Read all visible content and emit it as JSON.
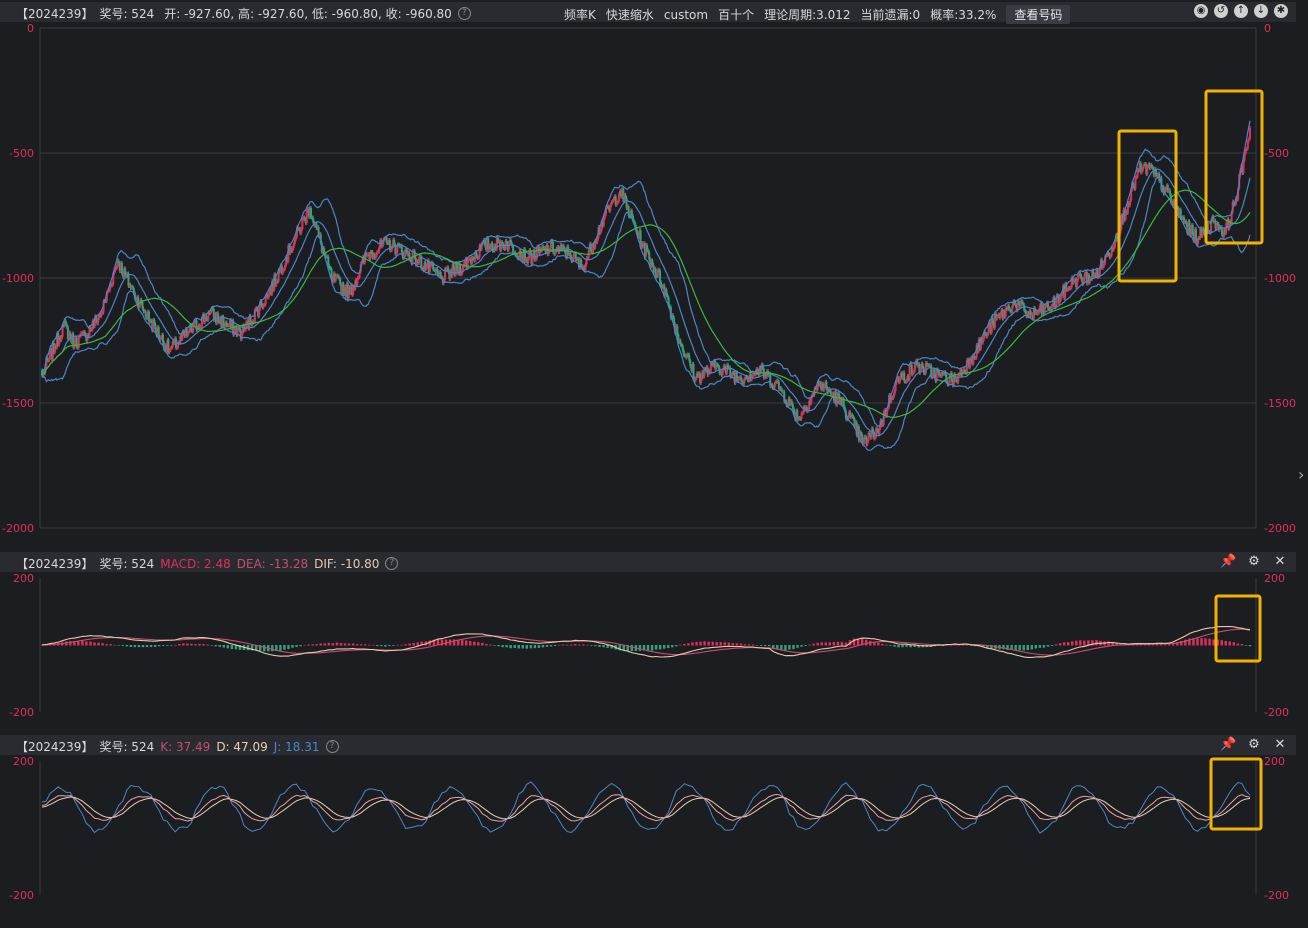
{
  "header": {
    "left": {
      "issue": "【2024239】",
      "label_no": "奖号: 524",
      "ohlc": "开: -927.60, 高: -927.60, 低: -960.80, 收: -960.80"
    },
    "center": {
      "items": [
        "频率K",
        "快速缩水",
        "custom",
        "百十个",
        "理论周期:3.012",
        "当前遗漏:0",
        "概率:33.2%"
      ],
      "button": "查看号码"
    },
    "icons": [
      "compass-icon",
      "undo-icon",
      "arrow-up-icon",
      "arrow-down-icon",
      "settings-icon"
    ]
  },
  "macd_header": {
    "issue": "【2024239】",
    "label_no": "奖号: 524",
    "macd": "MACD: 2.48",
    "dea": "DEA: -13.28",
    "dif": "DIF: -10.80"
  },
  "kdj_header": {
    "issue": "【2024239】",
    "label_no": "奖号: 524",
    "k": "K: 37.49",
    "d": "D: 47.09",
    "j": "J: 18.31"
  },
  "colors": {
    "up": "#e0305a",
    "down": "#2ea37c",
    "boll": "#4a86c8",
    "ma": "#3cb83c",
    "highlight": "#f0b400",
    "macd_dif": "#e8c8b0",
    "macd_dea": "#c05070",
    "kdj_k": "#e8a0a8",
    "kdj_d": "#e8d0b0",
    "kdj_j": "#4a86c8"
  },
  "chart_data": [
    {
      "type": "candlestick",
      "ylim": [
        -2000,
        0
      ],
      "y_ticks": [
        "0",
        "-500",
        "-1000",
        "-1500",
        "-2000"
      ],
      "grid": true,
      "anchors": [
        [
          0,
          -1390
        ],
        [
          12,
          -1270
        ],
        [
          20,
          -1190
        ],
        [
          30,
          -1260
        ],
        [
          40,
          -1230
        ],
        [
          55,
          -1140
        ],
        [
          70,
          -930
        ],
        [
          85,
          -1060
        ],
        [
          100,
          -1170
        ],
        [
          118,
          -1290
        ],
        [
          135,
          -1220
        ],
        [
          155,
          -1140
        ],
        [
          172,
          -1190
        ],
        [
          185,
          -1220
        ],
        [
          210,
          -1060
        ],
        [
          230,
          -880
        ],
        [
          248,
          -720
        ],
        [
          268,
          -1000
        ],
        [
          285,
          -1060
        ],
        [
          300,
          -910
        ],
        [
          320,
          -860
        ],
        [
          345,
          -920
        ],
        [
          370,
          -1000
        ],
        [
          390,
          -950
        ],
        [
          410,
          -870
        ],
        [
          430,
          -860
        ],
        [
          450,
          -920
        ],
        [
          470,
          -880
        ],
        [
          488,
          -900
        ],
        [
          500,
          -960
        ],
        [
          520,
          -760
        ],
        [
          535,
          -650
        ],
        [
          555,
          -860
        ],
        [
          575,
          -1030
        ],
        [
          590,
          -1250
        ],
        [
          605,
          -1400
        ],
        [
          625,
          -1350
        ],
        [
          645,
          -1400
        ],
        [
          665,
          -1370
        ],
        [
          683,
          -1440
        ],
        [
          700,
          -1560
        ],
        [
          720,
          -1420
        ],
        [
          740,
          -1500
        ],
        [
          760,
          -1660
        ],
        [
          775,
          -1600
        ],
        [
          790,
          -1420
        ],
        [
          810,
          -1350
        ],
        [
          830,
          -1390
        ],
        [
          845,
          -1410
        ],
        [
          860,
          -1320
        ],
        [
          880,
          -1180
        ],
        [
          900,
          -1100
        ],
        [
          915,
          -1150
        ],
        [
          935,
          -1110
        ],
        [
          955,
          -1010
        ],
        [
          975,
          -990
        ],
        [
          990,
          -880
        ],
        [
          1005,
          -700
        ],
        [
          1015,
          -570
        ],
        [
          1025,
          -560
        ],
        [
          1040,
          -650
        ],
        [
          1055,
          -760
        ],
        [
          1062,
          -810
        ],
        [
          1070,
          -840
        ],
        [
          1085,
          -770
        ],
        [
          1095,
          -820
        ],
        [
          1105,
          -680
        ],
        [
          1112,
          -530
        ],
        [
          1118,
          -400
        ]
      ],
      "highlight_boxes": 2
    },
    {
      "type": "macd",
      "ylim": [
        -200,
        200
      ],
      "y_ticks": [
        "200",
        "-200"
      ],
      "series": [
        "DIF",
        "DEA",
        "MACD"
      ]
    },
    {
      "type": "kdj",
      "ylim": [
        -200,
        200
      ],
      "y_ticks": [
        "200",
        "-200"
      ],
      "series": [
        "K",
        "D",
        "J"
      ],
      "highlight_boxes": 1
    }
  ]
}
